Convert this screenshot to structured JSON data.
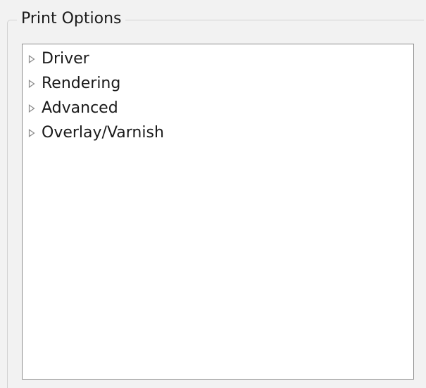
{
  "group": {
    "title": "Print Options"
  },
  "tree": {
    "items": [
      {
        "label": "Driver",
        "expander_icon": "triangle-right-outline-icon",
        "expanded": false
      },
      {
        "label": "Rendering",
        "expander_icon": "triangle-right-outline-icon",
        "expanded": false
      },
      {
        "label": "Advanced",
        "expander_icon": "triangle-right-outline-icon",
        "expanded": false
      },
      {
        "label": "Overlay/Varnish",
        "expander_icon": "triangle-right-outline-icon",
        "expanded": false
      }
    ]
  },
  "colors": {
    "window_bg": "#f2f2f2",
    "tree_bg": "#ffffff",
    "tree_border": "#8c8c8c",
    "frame_border": "#d2d2d2",
    "expander": "#8a8a8a",
    "text": "#1a1a1a"
  }
}
